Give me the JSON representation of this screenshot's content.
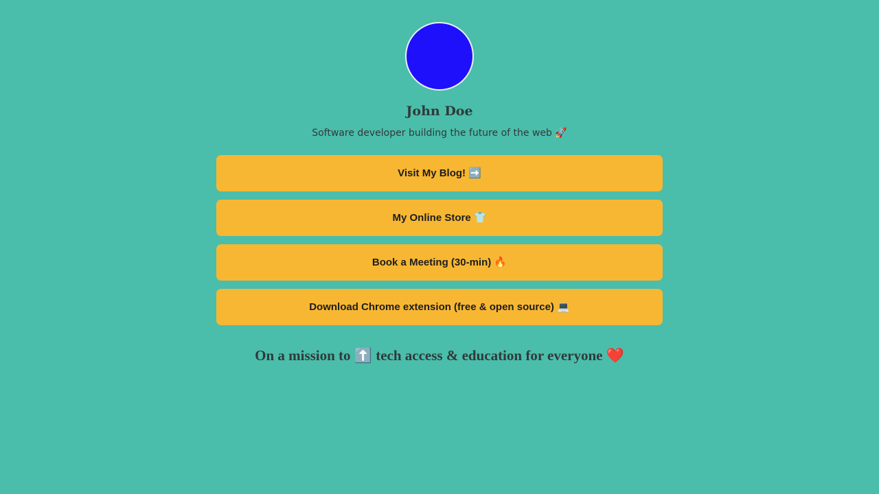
{
  "profile": {
    "avatar_color": "#1f10fb",
    "name": "John Doe",
    "bio": "Software developer building the future of the web 🚀"
  },
  "links": [
    {
      "label": "Visit My Blog! ➡️"
    },
    {
      "label": "My Online Store 👕"
    },
    {
      "label": "Book a Meeting (30-min) 🔥"
    },
    {
      "label": "Download Chrome extension (free & open source) 💻"
    }
  ],
  "footer": {
    "mission": "On a mission to ⬆️ tech access & education for everyone ❤️"
  },
  "colors": {
    "background": "#4bbdab",
    "button": "#f7b733",
    "text": "#2f3a3a"
  }
}
